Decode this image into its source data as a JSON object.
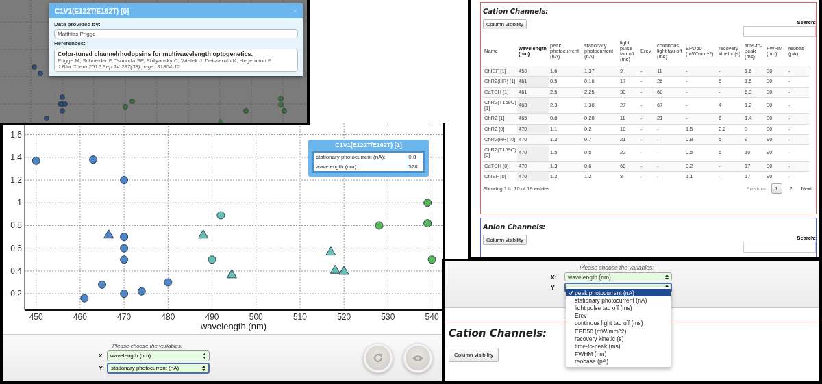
{
  "inset_popup_view": {
    "dialog": {
      "title": "C1V1(E122T/E162T) [0]",
      "close": "×",
      "provided_by_label": "Data provided by:",
      "provided_by": "Matthias Prigge",
      "references_label": "References:",
      "reference": {
        "title": "Color-tuned channelrhodopsins for multiwavelength optogenetics.",
        "authors": "Prigge M, Schneider F, Tsunoda SP, Shilyansky C, Wietek J, Deisseroth K, Hegemann P",
        "journal": "J Biol Chem 2012 Sep 14 287(38) page: 31804-12"
      }
    }
  },
  "plot_view": {
    "chart_data": {
      "type": "scatter",
      "grid": true,
      "xlabel": "wavelength (nm)",
      "xlim": [
        447.4,
        542.4
      ],
      "ylim": [
        0.056,
        1.7
      ],
      "xticks": [
        450,
        460,
        470,
        480,
        490,
        500,
        510,
        520,
        530,
        540
      ],
      "yticks": [
        0.2,
        0.4,
        0.6,
        0.8,
        1,
        1.2,
        1.4,
        1.6
      ],
      "series": [
        {
          "marker": "circle",
          "color": "#4f86c6",
          "x": [
            450,
            463,
            470,
            470,
            470,
            470,
            470,
            461,
            465,
            474,
            480
          ],
          "values": [
            1.37,
            1.38,
            1.2,
            0.7,
            0.6,
            0.5,
            0.2,
            0.16,
            0.28,
            0.22,
            0.3
          ]
        },
        {
          "marker": "triangle",
          "color": "#4f86c6",
          "x": [
            466.5
          ],
          "values": [
            0.72
          ]
        },
        {
          "marker": "circle",
          "color": "#66c2b4",
          "x": [
            492,
            490
          ],
          "values": [
            0.89,
            0.5
          ]
        },
        {
          "marker": "triangle",
          "color": "#66c2b4",
          "x": [
            488,
            494.5,
            517,
            518,
            520
          ],
          "values": [
            0.72,
            0.37,
            0.57,
            0.41,
            0.4
          ]
        },
        {
          "marker": "circle",
          "color": "#5cb85c",
          "x": [
            528,
            539,
            539,
            540
          ],
          "values": [
            0.8,
            1.0,
            0.82,
            0.5
          ]
        }
      ]
    },
    "tooltip": {
      "title": "C1V1(E122T/E162T) [1]",
      "rows": [
        {
          "label": "stationary photocurrent (nA):",
          "value": "0.8"
        },
        {
          "label": "wavelength (nm):",
          "value": "528"
        }
      ]
    },
    "controls": {
      "prompt": "Please choose the variables:",
      "x": {
        "label": "X:",
        "value": "wavelength (nm)",
        "focused": false
      },
      "y": {
        "label": "Y:",
        "value": "stationary photocurrent (nA)",
        "focused": true
      }
    },
    "buttons": [
      {
        "kind": "refresh"
      },
      {
        "kind": "eye"
      }
    ]
  },
  "table_view": {
    "cation": {
      "title": "Cation Channels:",
      "column_visibility": "Column visibility",
      "search_label": "Search:",
      "columns": [
        {
          "label": "Name",
          "sorted": false
        },
        {
          "label": "wavelength (nm)",
          "sorted": true
        },
        {
          "label": "peak photocurrent (nA)",
          "sorted": false
        },
        {
          "label": "stationary photocurrent (nA)",
          "sorted": false
        },
        {
          "label": "light pulse tau off (ms)",
          "sorted": false
        },
        {
          "label": "Erev",
          "sorted": false
        },
        {
          "label": "continous light tau off (ms)",
          "sorted": false
        },
        {
          "label": "EPD50 (mW/mm^2)",
          "sorted": false
        },
        {
          "label": "recovery kinetic (s)",
          "sorted": false
        },
        {
          "label": "time-to-peak (ms)",
          "sorted": false
        },
        {
          "label": "FWHM (nm)",
          "sorted": false
        },
        {
          "label": "reobas (pA)",
          "sorted": false
        }
      ],
      "rows": [
        [
          "ChIEF [1]",
          "450",
          "1.6",
          "1.37",
          "9",
          "-",
          "11",
          "-",
          "-",
          "1.6",
          "90",
          "-"
        ],
        [
          "ChR2(HR) [1]",
          "461",
          "0.5",
          "0.16",
          "17",
          "-",
          "26",
          "-",
          "6",
          "1.5",
          "90",
          "-"
        ],
        [
          "CaTCH [1]",
          "461",
          "2.5",
          "2.25",
          "30",
          "-",
          "68",
          "-",
          "-",
          "6.3",
          "90",
          "-"
        ],
        [
          "ChR2(T159C) [1]",
          "463",
          "2.3",
          "1.38",
          "27",
          "-",
          "67",
          "-",
          "4",
          "1.2",
          "90",
          "-"
        ],
        [
          "ChR2 [1]",
          "465",
          "0.8",
          "0.28",
          "11",
          "-",
          "21",
          "-",
          "6",
          "1.4",
          "90",
          "-"
        ],
        [
          "ChR2 [0]",
          "470",
          "1.1",
          "0.2",
          "10",
          "-",
          "-",
          "1.5",
          "2.2",
          "9",
          "90",
          "-"
        ],
        [
          "ChR2(HR) [0]",
          "470",
          "1.3",
          "0.7",
          "21",
          "-",
          "-",
          "0.8",
          "5",
          "9",
          "90",
          "-"
        ],
        [
          "ChR2(T159C) [0]",
          "470",
          "1.5",
          "0.5",
          "22",
          "-",
          "-",
          "0.5",
          "5",
          "10",
          "90",
          "-"
        ],
        [
          "CaTCH [0]",
          "470",
          "1.3",
          "0.6",
          "60",
          "-",
          "-",
          "0.2",
          "-",
          "17",
          "90",
          "-"
        ],
        [
          "ChIEF [0]",
          "470",
          "1.3",
          "1.2",
          "8",
          "-",
          "-",
          "1.1",
          "-",
          "17",
          "90",
          "-"
        ]
      ],
      "info": "Showing 1 to 10 of 19 entries",
      "pagination": [
        {
          "kind": "previous",
          "label": "Previous",
          "selected": false,
          "disabled": true
        },
        {
          "kind": "page",
          "label": "1",
          "selected": true,
          "disabled": false
        },
        {
          "kind": "page",
          "label": "2",
          "selected": false,
          "disabled": false
        },
        {
          "kind": "next",
          "label": "Next",
          "selected": false,
          "disabled": false
        }
      ]
    },
    "anion": {
      "title": "Anion Channels:",
      "column_visibility": "Column visibility",
      "search_label": "Search:"
    }
  },
  "dropdown_view": {
    "prompt": "Please choose the variables:",
    "x": {
      "label": "X:",
      "value": "wavelength (nm)"
    },
    "y_label": "Y",
    "options": [
      {
        "label": "peak photocurrent (nA)",
        "selected": true
      },
      {
        "label": "stationary photocurrent (nA)",
        "selected": false
      },
      {
        "label": "light pulse tau off (ms)",
        "selected": false
      },
      {
        "label": "Erev",
        "selected": false
      },
      {
        "label": "continous light tau off (ms)",
        "selected": false
      },
      {
        "label": "EPD50 (mW/mm^2)",
        "selected": false
      },
      {
        "label": "recovery kinetic (s)",
        "selected": false
      },
      {
        "label": "time-to-peak (ms)",
        "selected": false
      },
      {
        "label": "FWHM (nm)",
        "selected": false
      },
      {
        "label": "reobase (pA)",
        "selected": false
      }
    ],
    "section_title": "Cation Channels:",
    "column_visibility": "Column visibility"
  }
}
